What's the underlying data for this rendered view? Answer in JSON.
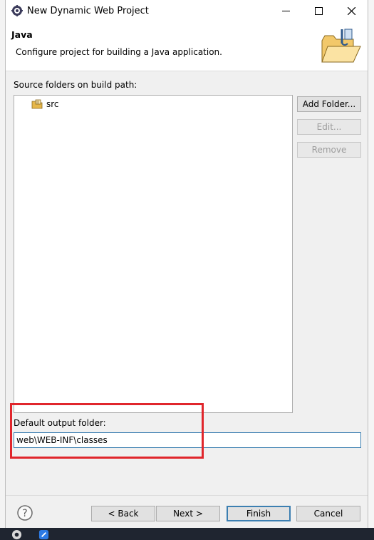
{
  "window": {
    "title": "New Dynamic Web Project",
    "icons": {
      "app": "eclipse-gear-icon",
      "minimize": "minimize-icon",
      "maximize": "maximize-icon",
      "close": "close-icon"
    }
  },
  "header": {
    "title": "Java",
    "description": "Configure project for building a Java application.",
    "image": "open-folder-java-icon"
  },
  "source": {
    "label": "Source folders on build path:",
    "items": [
      {
        "label": "src",
        "icon": "source-package-folder-icon"
      }
    ]
  },
  "side_buttons": {
    "add_folder": "Add Folder...",
    "edit": "Edit...",
    "remove": "Remove"
  },
  "output": {
    "label": "Default output folder:",
    "value": "web\\WEB-INF\\classes"
  },
  "footer": {
    "help_icon": "help-question-icon",
    "back": "< Back",
    "next": "Next >",
    "finish": "Finish",
    "cancel": "Cancel"
  },
  "colors": {
    "highlight_box": "#e0262c",
    "focus_border": "#3c7fb1",
    "dialog_bg": "#f0f0f0"
  }
}
